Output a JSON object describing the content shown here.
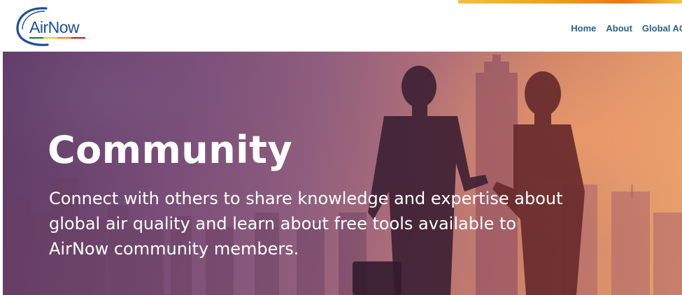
{
  "header": {
    "logo_text": "AirNow",
    "nav": [
      {
        "label": "Home"
      },
      {
        "label": "About"
      },
      {
        "label": "Global AQ"
      }
    ]
  },
  "hero": {
    "title": "Community",
    "description": "Connect with others to share knowledge and expertise about global air quality and learn about free tools available to AirNow community members."
  },
  "colors": {
    "brand_blue": "#1b4e9b",
    "nav_link": "#2a5f8f",
    "hero_text": "#ffffff"
  }
}
